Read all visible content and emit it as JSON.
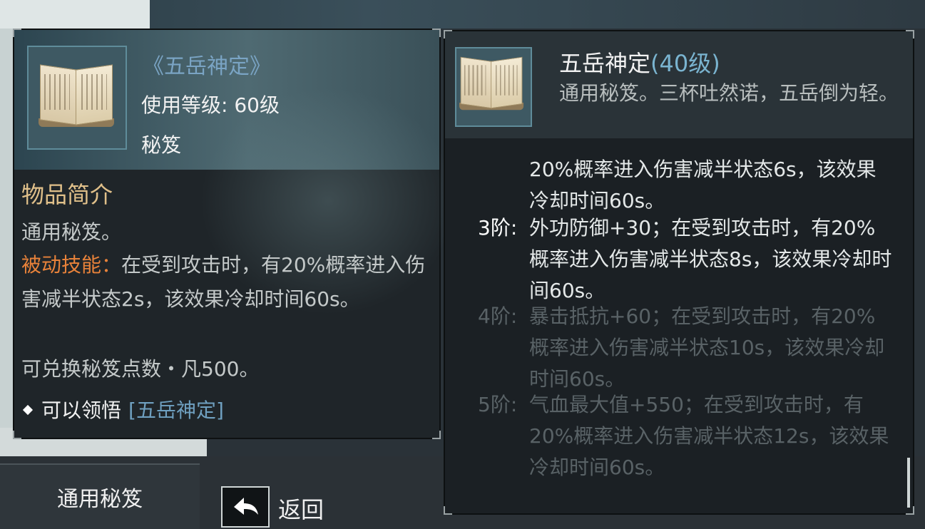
{
  "left_tooltip": {
    "item_title": "《五岳神定》",
    "use_level": "使用等级: 60级",
    "item_type": "秘笈",
    "section_heading": "物品简介",
    "intro": "通用秘笈。",
    "passive_label": "被动技能：",
    "passive_text": "在受到攻击时，有20%概率进入伤害减半状态2s，该效果冷却时间60s。",
    "exchange": "可兑换秘笈点数・凡500。",
    "learn_prefix": "可以领悟",
    "learn_link": "[五岳神定]"
  },
  "right_panel": {
    "name": "五岳神定",
    "level": "(40级)",
    "description": "通用秘笈。三杯吐然诺，五岳倒为轻。",
    "tiers": [
      {
        "label": "",
        "text": "20%概率进入伤害减半状态6s，该效果冷却时间60s。",
        "active": true
      },
      {
        "label": "3阶:",
        "text": "外功防御+30；在受到攻击时，有20%概率进入伤害减半状态8s，该效果冷却时间60s。",
        "active": true
      },
      {
        "label": "4阶:",
        "text": "暴击抵抗+60；在受到攻击时，有20%概率进入伤害减半状态10s，该效果冷却时间60s。",
        "active": false
      },
      {
        "label": "5阶:",
        "text": "气血最大值+550；在受到攻击时，有20%概率进入伤害减半状态12s，该效果冷却时间60s。",
        "active": false
      }
    ]
  },
  "bottom": {
    "tab_label": "通用秘笈",
    "back_label": "返回"
  },
  "colors": {
    "title_blue": "#7aa4c4",
    "skill_orange": "#e8823a",
    "heading_gold": "#e0c08a",
    "inactive_grey": "#596266"
  }
}
